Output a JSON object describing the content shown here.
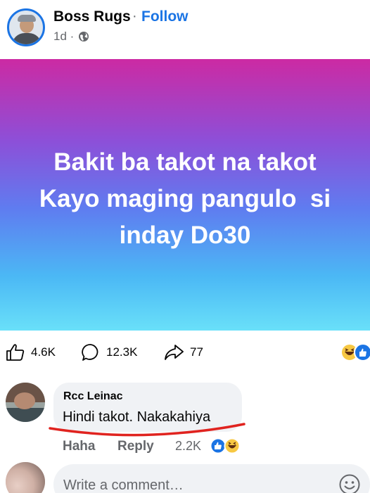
{
  "post": {
    "author": "Boss Rugs",
    "separator": "·",
    "follow_label": "Follow",
    "time": "1d ·",
    "privacy_icon": "globe-icon",
    "text": "Bakit ba takot na takot\nKayo maging pangulo  si\ninday Do30",
    "background_colors": [
      "#cc2aa3",
      "#8d4fd8",
      "#5f7cf0",
      "#4bb8f5",
      "#69e0f9"
    ]
  },
  "actions": {
    "like_count": "4.6K",
    "comment_count": "12.3K",
    "share_count": "77",
    "top_reactions": [
      "haha-reaction-icon",
      "like-reaction-icon"
    ]
  },
  "comment": {
    "name": "Rcc Leinac",
    "text": "Hindi takot. Nakakahiya",
    "haha_label": "Haha",
    "reply_label": "Reply",
    "reaction_count": "2.2K",
    "reactions": [
      "like-reaction-icon",
      "haha-reaction-icon"
    ],
    "annotation_color": "#e0231f"
  },
  "composer": {
    "placeholder": "Write a comment…",
    "emoji_icon": "smile-icon"
  },
  "colors": {
    "accent": "#1b74e4",
    "secondary_text": "#65676b",
    "bubble": "#f0f2f5"
  }
}
